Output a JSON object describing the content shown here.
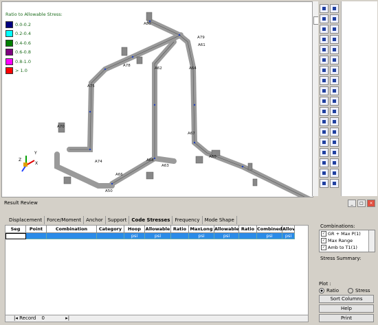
{
  "viewport": {
    "legend": {
      "title": "Ratio to Allowable Stress:",
      "items": [
        {
          "label": "0.0-0.2",
          "color": "#000080"
        },
        {
          "label": "0.2-0.4",
          "color": "#00ffff"
        },
        {
          "label": "0.4-0.6",
          "color": "#008000"
        },
        {
          "label": "0.6-0.8",
          "color": "#800080"
        },
        {
          "label": "0.8-1.0",
          "color": "#ff00ff"
        },
        {
          "label": "> 1.0",
          "color": "#ff0000"
        }
      ]
    },
    "node_labels": {
      "a80": "A80",
      "a79": "A79",
      "a61": "A61",
      "a78": "A78",
      "a62": "A62",
      "a64": "A64",
      "a75": "A75",
      "a70": "A70",
      "a74": "A74",
      "a66": "A66",
      "a68": "A68",
      "a63": "A63",
      "a67": "A67",
      "a60": "A60",
      "a50": "A50"
    },
    "axis": {
      "x": "X",
      "y": "Y",
      "z": "Z"
    }
  },
  "panel": {
    "title": "Result Review",
    "tabs": [
      "Displacement",
      "Force/Moment",
      "Anchor",
      "Support",
      "Code Stresses",
      "Frequency",
      "Mode Shape"
    ],
    "active_tab": "Code Stresses",
    "columns": [
      "Seg",
      "Point",
      "Combination",
      "Category",
      "Hoop",
      "Allowable",
      "Ratio",
      "MaxLong",
      "Allowable",
      "Ratio",
      "Combined",
      "Allov"
    ],
    "units": [
      "",
      "",
      "",
      "",
      "psi",
      "psi",
      "",
      "psi",
      "psi",
      "",
      "psi",
      "psi"
    ],
    "record_label": "Record",
    "record_value": "0"
  },
  "side": {
    "combinations_label": "Combinations:",
    "combinations": [
      "GR + Max P(1)",
      "Max Range",
      "Amb to T1(1)"
    ],
    "stress_summary_label": "Stress Summary:",
    "plot_label": "Plot :",
    "plot_options": [
      "Ratio",
      "Stress"
    ],
    "plot_selected": "Ratio",
    "buttons": {
      "sort": "Sort Columns",
      "help": "Help",
      "print": "Print"
    }
  }
}
